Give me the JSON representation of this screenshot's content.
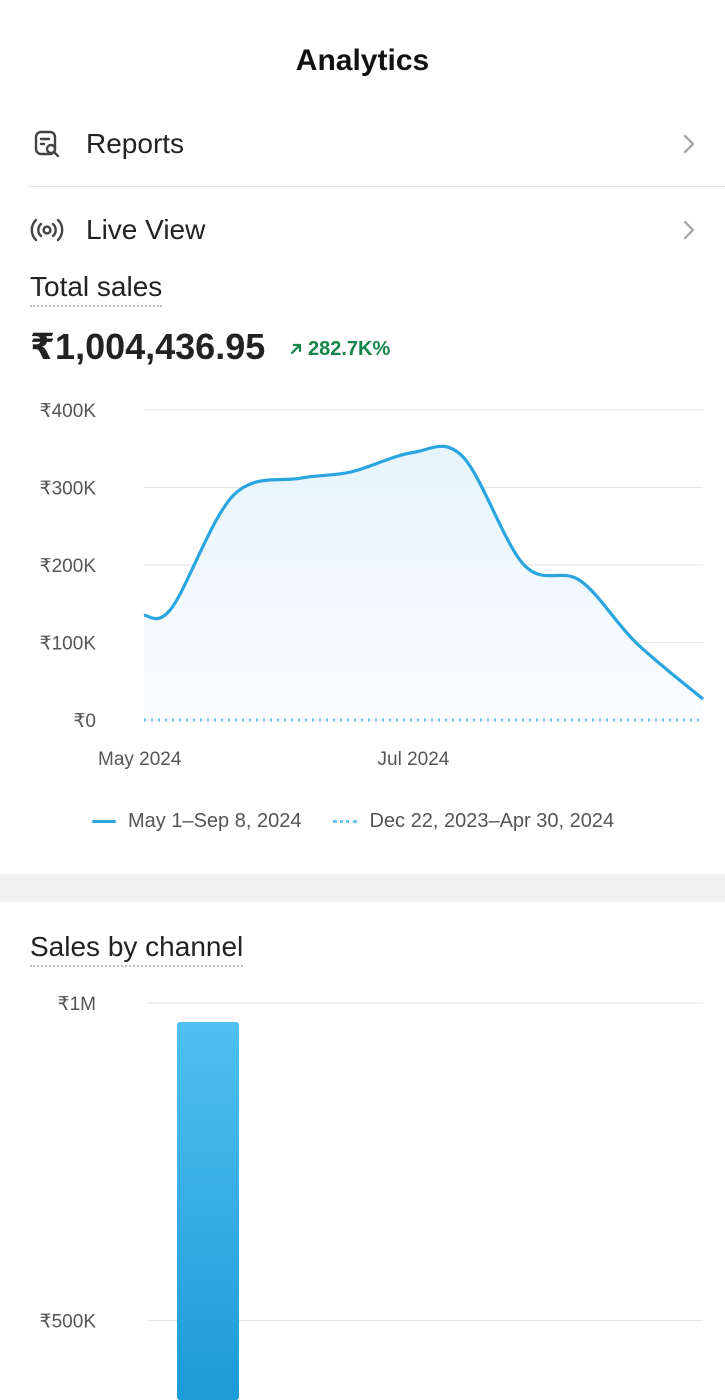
{
  "header": {
    "title": "Analytics"
  },
  "nav": [
    {
      "label": "Reports",
      "icon": "report-search-icon"
    },
    {
      "label": "Live View",
      "icon": "live-signal-icon"
    }
  ],
  "total_sales": {
    "title": "Total sales",
    "value": "₹1,004,436.95",
    "change": "282.7K%",
    "legend_current": "May 1–Sep 8, 2024",
    "legend_previous": "Dec 22, 2023–Apr 30, 2024"
  },
  "sales_by_channel": {
    "title": "Sales by channel"
  },
  "colors": {
    "accent": "#2aa5df",
    "positive": "#14854a",
    "gridline": "#e6e6e6"
  },
  "chart_data": [
    {
      "type": "area",
      "title": "Total sales",
      "y_ticks": [
        "₹0",
        "₹100K",
        "₹200K",
        "₹300K",
        "₹400K"
      ],
      "y_tick_values": [
        0,
        100000,
        200000,
        300000,
        400000
      ],
      "ylim": [
        0,
        400000
      ],
      "x_tick_labels": [
        {
          "label": "May 2024",
          "at": 0
        },
        {
          "label": "Jul 2024",
          "at": 0.5
        }
      ],
      "series": [
        {
          "name": "May 1–Sep 8, 2024",
          "style": "solid",
          "x": [
            0,
            0.05,
            0.16,
            0.28,
            0.37,
            0.48,
            0.57,
            0.68,
            0.78,
            0.88,
            1.0
          ],
          "y": [
            135000,
            145000,
            290000,
            312000,
            320000,
            345000,
            340000,
            200000,
            180000,
            100000,
            27000
          ]
        },
        {
          "name": "Dec 22, 2023–Apr 30, 2024",
          "style": "dotted",
          "x": [
            0,
            1.0
          ],
          "y": [
            0,
            0
          ]
        }
      ],
      "grid": true,
      "legend": "bottom"
    },
    {
      "type": "bar",
      "title": "Sales by channel",
      "y_ticks": [
        "₹500K",
        "₹1M"
      ],
      "y_tick_values": [
        500000,
        1000000
      ],
      "ylim": [
        0,
        1000000
      ],
      "values": [
        970000
      ],
      "grid": true
    }
  ]
}
